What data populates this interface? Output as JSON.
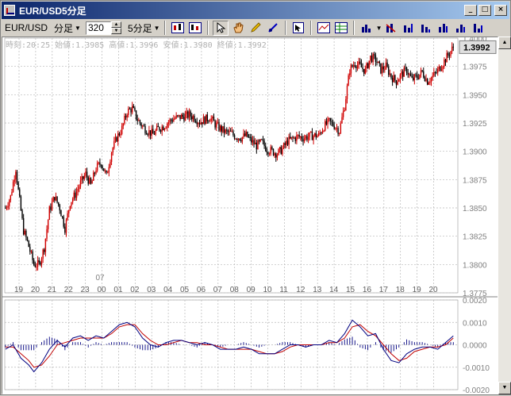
{
  "window": {
    "title": "EUR/USD5分足",
    "buttons": {
      "minimize": "_",
      "maximize": "□",
      "close": "×"
    }
  },
  "toolbar": {
    "symbol": "EUR/USD",
    "bar_type": "分足",
    "count": "320",
    "interval": "5分足",
    "icons": [
      "bid-chart-icon",
      "ask-chart-icon",
      "cursor-icon",
      "hand-icon",
      "pencil-icon",
      "line-tool-icon",
      "crosshair-icon",
      "table-icon",
      "grid-icon",
      "bar-chart-icon",
      "indicator-icon",
      "indicator-2-icon",
      "indicator-3-icon",
      "indicator-4-icon",
      "indicator-5-icon",
      "indicator-6-icon"
    ]
  },
  "info": {
    "line": "時刻:20:25 始値:1.3985 高値:1.3996 安値:1.3980 終値:1.3992"
  },
  "colors": {
    "up": "#d00000",
    "down": "#000000",
    "grid": "#b8b8b8",
    "macd": "#000080",
    "signal": "#c00000",
    "price_tag_bg": "#e0e0e0"
  },
  "chart_data": [
    {
      "type": "candlestick",
      "x_tick_labels": [
        "19",
        "20",
        "21",
        "22",
        "23",
        "00",
        "01",
        "02",
        "03",
        "04",
        "05",
        "06",
        "07",
        "08",
        "09",
        "10",
        "11",
        "12",
        "13",
        "14",
        "15",
        "16",
        "17",
        "18",
        "19",
        "20"
      ],
      "date_marker": "07",
      "y_tick_labels": [
        "1.4000",
        "1.3975",
        "1.3950",
        "1.3925",
        "1.3900",
        "1.3875",
        "1.3850",
        "1.3825",
        "1.3800",
        "1.3775"
      ],
      "ylim": [
        1.3775,
        1.4
      ],
      "current_price": "1.3992",
      "path": [
        [
          0,
          1.385
        ],
        [
          4,
          1.386
        ],
        [
          8,
          1.3885
        ],
        [
          10,
          1.3865
        ],
        [
          14,
          1.383
        ],
        [
          17,
          1.382
        ],
        [
          22,
          1.38
        ],
        [
          26,
          1.38
        ],
        [
          30,
          1.3815
        ],
        [
          34,
          1.3848
        ],
        [
          38,
          1.386
        ],
        [
          42,
          1.385
        ],
        [
          46,
          1.3832
        ],
        [
          50,
          1.3855
        ],
        [
          54,
          1.3862
        ],
        [
          58,
          1.3872
        ],
        [
          62,
          1.388
        ],
        [
          66,
          1.387
        ],
        [
          70,
          1.3885
        ],
        [
          74,
          1.389
        ],
        [
          78,
          1.3878
        ],
        [
          82,
          1.39
        ],
        [
          86,
          1.3912
        ],
        [
          90,
          1.392
        ],
        [
          94,
          1.3935
        ],
        [
          98,
          1.3938
        ],
        [
          102,
          1.3928
        ],
        [
          106,
          1.3922
        ],
        [
          110,
          1.3918
        ],
        [
          114,
          1.3915
        ],
        [
          118,
          1.392
        ],
        [
          122,
          1.3922
        ],
        [
          126,
          1.3926
        ],
        [
          130,
          1.3929
        ],
        [
          134,
          1.393
        ],
        [
          138,
          1.3931
        ],
        [
          142,
          1.3932
        ],
        [
          146,
          1.393
        ],
        [
          150,
          1.3926
        ],
        [
          154,
          1.3928
        ],
        [
          158,
          1.393
        ],
        [
          162,
          1.3924
        ],
        [
          166,
          1.392
        ],
        [
          170,
          1.3917
        ],
        [
          174,
          1.3916
        ],
        [
          178,
          1.3913
        ],
        [
          182,
          1.3912
        ],
        [
          186,
          1.3914
        ],
        [
          190,
          1.3909
        ],
        [
          194,
          1.3905
        ],
        [
          198,
          1.3908
        ],
        [
          202,
          1.3902
        ],
        [
          206,
          1.39
        ],
        [
          210,
          1.3898
        ],
        [
          214,
          1.3902
        ],
        [
          218,
          1.3909
        ],
        [
          222,
          1.3911
        ],
        [
          226,
          1.3913
        ],
        [
          230,
          1.3912
        ],
        [
          234,
          1.3913
        ],
        [
          238,
          1.3914
        ],
        [
          242,
          1.3914
        ],
        [
          246,
          1.3922
        ],
        [
          250,
          1.3926
        ],
        [
          254,
          1.3923
        ],
        [
          258,
          1.3918
        ],
        [
          262,
          1.394
        ],
        [
          266,
          1.3972
        ],
        [
          270,
          1.3978
        ],
        [
          274,
          1.3975
        ],
        [
          278,
          1.3971
        ],
        [
          282,
          1.3983
        ],
        [
          286,
          1.3981
        ],
        [
          290,
          1.3972
        ],
        [
          294,
          1.3975
        ],
        [
          298,
          1.3966
        ],
        [
          302,
          1.3962
        ],
        [
          306,
          1.3968
        ],
        [
          310,
          1.3972
        ],
        [
          314,
          1.3963
        ],
        [
          318,
          1.3966
        ],
        [
          322,
          1.397
        ],
        [
          326,
          1.3962
        ],
        [
          330,
          1.3966
        ],
        [
          334,
          1.3971
        ],
        [
          338,
          1.3978
        ],
        [
          342,
          1.3985
        ],
        [
          346,
          1.3992
        ]
      ]
    },
    {
      "type": "line",
      "name_macd": "MACD",
      "y_tick_labels": [
        "0.0020",
        "0.0010",
        "0.0000",
        "-0.0010",
        "-0.0020"
      ],
      "ylim": [
        -0.002,
        0.002
      ],
      "macd": [
        [
          0,
          -0.0002
        ],
        [
          6,
          0.0
        ],
        [
          12,
          -0.0006
        ],
        [
          18,
          -0.0009
        ],
        [
          22,
          -0.0012
        ],
        [
          28,
          -0.0008
        ],
        [
          34,
          -0.0002
        ],
        [
          40,
          0.0002
        ],
        [
          46,
          -0.0001
        ],
        [
          52,
          0.0003
        ],
        [
          58,
          0.0004
        ],
        [
          64,
          0.0002
        ],
        [
          70,
          0.0004
        ],
        [
          76,
          0.0003
        ],
        [
          82,
          0.0006
        ],
        [
          88,
          0.0009
        ],
        [
          94,
          0.001
        ],
        [
          100,
          0.0008
        ],
        [
          106,
          0.0003
        ],
        [
          112,
          0.0
        ],
        [
          118,
          -0.0001
        ],
        [
          124,
          0.0001
        ],
        [
          130,
          0.0002
        ],
        [
          136,
          0.0002
        ],
        [
          142,
          0.0001
        ],
        [
          148,
          0.0
        ],
        [
          154,
          0.0001
        ],
        [
          160,
          0.0
        ],
        [
          166,
          -0.0002
        ],
        [
          172,
          -0.0002
        ],
        [
          178,
          -0.0002
        ],
        [
          184,
          -0.0001
        ],
        [
          190,
          -0.0002
        ],
        [
          196,
          -0.0004
        ],
        [
          202,
          -0.0004
        ],
        [
          208,
          -0.0004
        ],
        [
          214,
          -0.0002
        ],
        [
          220,
          0.0
        ],
        [
          226,
          0.0
        ],
        [
          232,
          -0.0001
        ],
        [
          238,
          0.0
        ],
        [
          244,
          0.0
        ],
        [
          250,
          0.0002
        ],
        [
          256,
          0.0001
        ],
        [
          262,
          0.0005
        ],
        [
          268,
          0.0011
        ],
        [
          274,
          0.0008
        ],
        [
          280,
          0.0004
        ],
        [
          286,
          0.0005
        ],
        [
          292,
          -0.0002
        ],
        [
          298,
          -0.0007
        ],
        [
          304,
          -0.0008
        ],
        [
          310,
          -0.0004
        ],
        [
          316,
          -0.0002
        ],
        [
          322,
          -0.0001
        ],
        [
          328,
          -0.0001
        ],
        [
          334,
          -0.0002
        ],
        [
          340,
          0.0001
        ],
        [
          346,
          0.0004
        ]
      ],
      "signal": [
        [
          0,
          -0.0001
        ],
        [
          6,
          -0.0001
        ],
        [
          12,
          -0.0004
        ],
        [
          18,
          -0.0007
        ],
        [
          22,
          -0.001
        ],
        [
          28,
          -0.0009
        ],
        [
          34,
          -0.0005
        ],
        [
          40,
          0.0
        ],
        [
          46,
          0.0001
        ],
        [
          52,
          0.0002
        ],
        [
          58,
          0.0003
        ],
        [
          64,
          0.0003
        ],
        [
          70,
          0.0003
        ],
        [
          76,
          0.0003
        ],
        [
          82,
          0.0005
        ],
        [
          88,
          0.0008
        ],
        [
          94,
          0.0009
        ],
        [
          100,
          0.0009
        ],
        [
          106,
          0.0005
        ],
        [
          112,
          0.0002
        ],
        [
          118,
          0.0
        ],
        [
          124,
          0.0
        ],
        [
          130,
          0.0001
        ],
        [
          136,
          0.0002
        ],
        [
          142,
          0.0001
        ],
        [
          148,
          0.0001
        ],
        [
          154,
          0.0
        ],
        [
          160,
          0.0
        ],
        [
          166,
          -0.0001
        ],
        [
          172,
          -0.0002
        ],
        [
          178,
          -0.0002
        ],
        [
          184,
          -0.0002
        ],
        [
          190,
          -0.0002
        ],
        [
          196,
          -0.0003
        ],
        [
          202,
          -0.0004
        ],
        [
          208,
          -0.0004
        ],
        [
          214,
          -0.0003
        ],
        [
          220,
          -0.0001
        ],
        [
          226,
          0.0
        ],
        [
          232,
          0.0
        ],
        [
          238,
          0.0
        ],
        [
          244,
          0.0
        ],
        [
          250,
          0.0001
        ],
        [
          256,
          0.0001
        ],
        [
          262,
          0.0003
        ],
        [
          268,
          0.0008
        ],
        [
          274,
          0.0009
        ],
        [
          280,
          0.0006
        ],
        [
          286,
          0.0004
        ],
        [
          292,
          0.0
        ],
        [
          298,
          -0.0004
        ],
        [
          304,
          -0.0007
        ],
        [
          310,
          -0.0006
        ],
        [
          316,
          -0.0003
        ],
        [
          322,
          -0.0002
        ],
        [
          328,
          -0.0001
        ],
        [
          334,
          -0.0001
        ],
        [
          340,
          0.0
        ],
        [
          346,
          0.0003
        ]
      ]
    }
  ]
}
